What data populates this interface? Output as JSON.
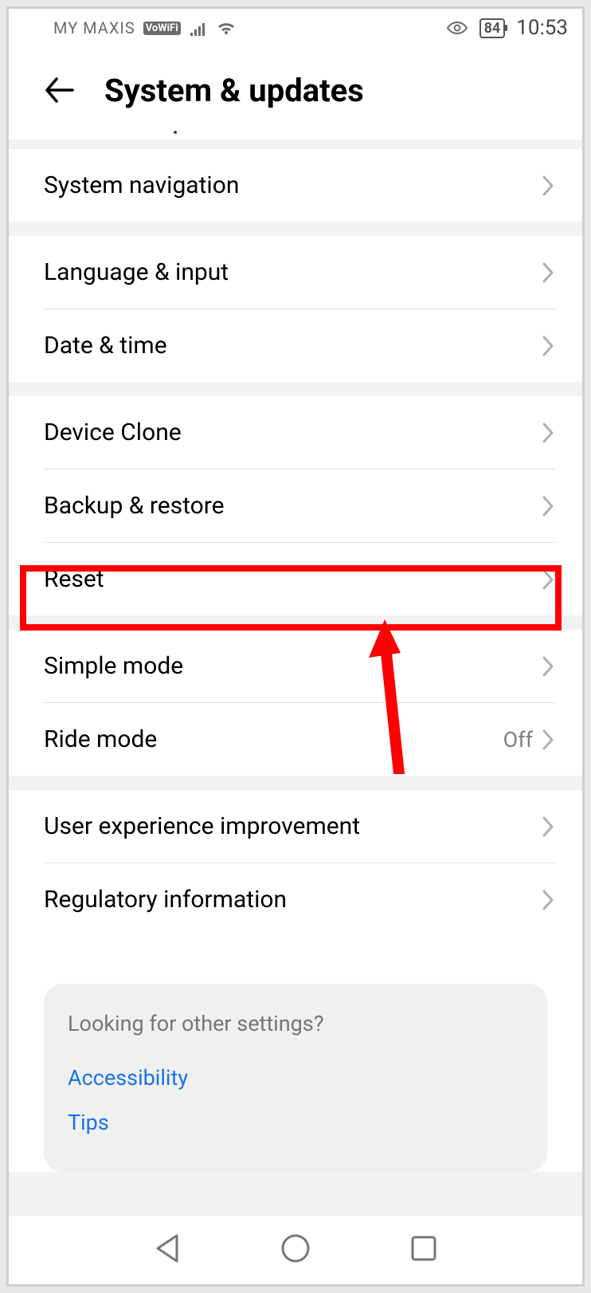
{
  "statusbar": {
    "carrier": "MY MAXIS",
    "vowifi": "VoWiFi",
    "battery": "84",
    "time": "10:53"
  },
  "header": {
    "title": "System & updates"
  },
  "rows": {
    "system_navigation": "System navigation",
    "language_input": "Language & input",
    "date_time": "Date & time",
    "device_clone": "Device Clone",
    "backup_restore": "Backup & restore",
    "reset": "Reset",
    "simple_mode": "Simple mode",
    "ride_mode": "Ride mode",
    "ride_mode_value": "Off",
    "user_experience": "User experience improvement",
    "regulatory": "Regulatory information"
  },
  "other": {
    "title": "Looking for other settings?",
    "accessibility": "Accessibility",
    "tips": "Tips"
  }
}
